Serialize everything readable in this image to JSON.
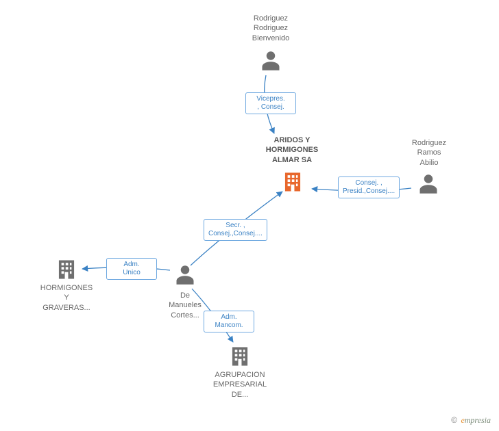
{
  "nodes": {
    "person_top": {
      "label": "Rodriguez\nRodriguez\nBienvenido"
    },
    "person_right": {
      "label": "Rodriguez\nRamos\nAbilio"
    },
    "person_center": {
      "label": "De\nManueles\nCortes..."
    },
    "company_main": {
      "label": "ARIDOS Y\nHORMIGONES\nALMAR SA"
    },
    "company_left": {
      "label": "HORMIGONES\nY\nGRAVERAS..."
    },
    "company_bottom": {
      "label": "AGRUPACION\nEMPRESARIAL\nDE..."
    }
  },
  "edges": {
    "e_top": {
      "label": "Vicepres.\n, Consej."
    },
    "e_right": {
      "label": "Consej. ,\nPresid.,Consej...."
    },
    "e_center": {
      "label": "Secr. ,\nConsej.,Consej...."
    },
    "e_left": {
      "label": "Adm.\nUnico"
    },
    "e_bottom": {
      "label": "Adm.\nMancom."
    }
  },
  "footer": {
    "copyright": "©",
    "brand_first": "e",
    "brand_rest": "mpresia"
  }
}
